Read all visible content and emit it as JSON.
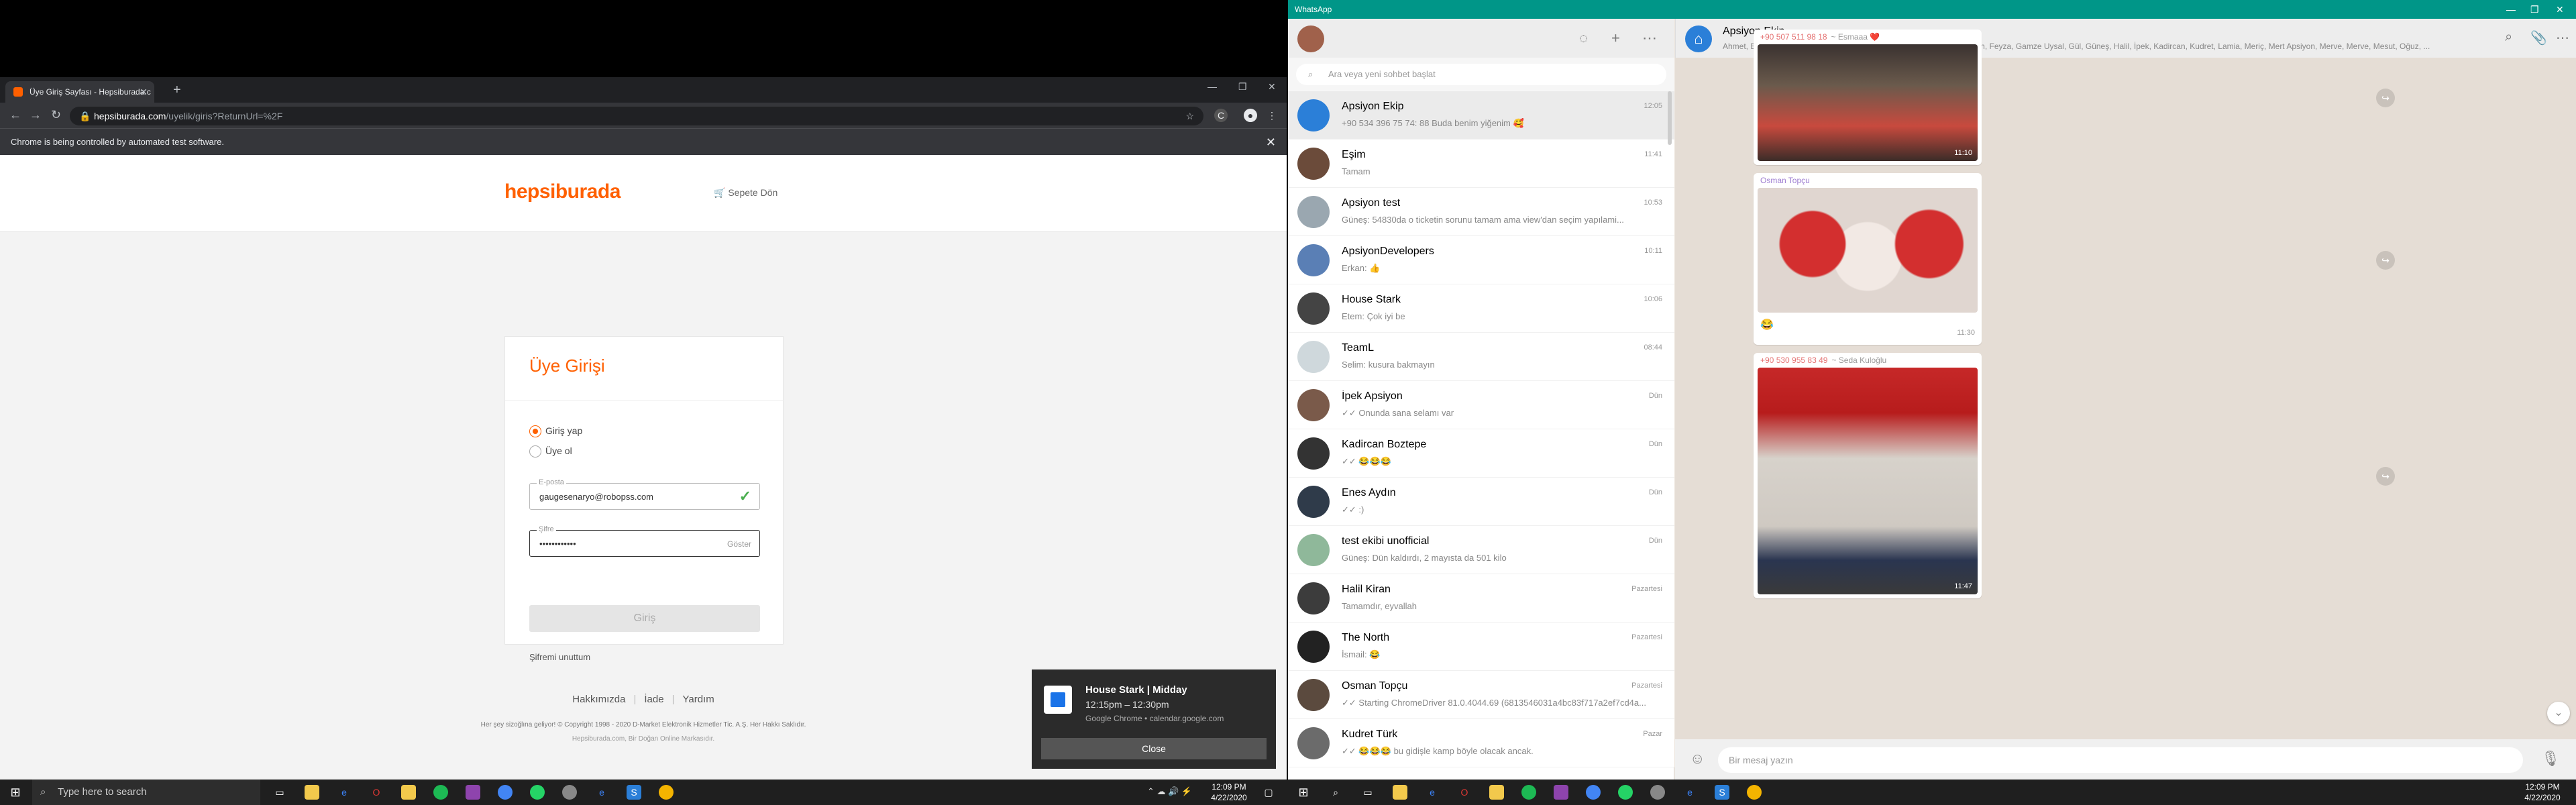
{
  "chrome": {
    "tab_title": "Üye Giriş Sayfası - Hepsiburada.c",
    "url_host": "hepsiburada.com",
    "url_path": "/uyelik/giris?ReturnUrl=%2F",
    "infobar": "Chrome is being controlled by automated test software."
  },
  "hepsiburada": {
    "logo": "hepsiburada",
    "cart_link": "Sepete Dön",
    "login_title": "Üye Girişi",
    "radio_login": "Giriş yap",
    "radio_register": "Üye ol",
    "email_label": "E-posta",
    "email_value": "gaugesenaryo@robopss.com",
    "password_label": "Şifre",
    "password_value": "••••••••••••",
    "show_label": "Göster",
    "login_button": "Giriş",
    "forgot_link": "Şifremi unuttum",
    "footer_links": [
      "Hakkımızda",
      "İade",
      "Yardım"
    ],
    "copyright": "Her şey sizoğlına geliyor! © Copyright 1998 - 2020 D-Market Elektronik Hizmetler Tic. A.Ş. Her Hakkı Saklıdır.",
    "sub_copyright": "Hepsiburada.com, Bir Doğan Online Markasıdır."
  },
  "toast": {
    "title": "House Stark | Midday",
    "time": "12:15pm – 12:30pm",
    "source": "Google Chrome • calendar.google.com",
    "close": "Close"
  },
  "taskbar_left": {
    "search_placeholder": "Type here to search",
    "time": "12:09 PM",
    "date": "4/22/2020"
  },
  "taskbar_right": {
    "time": "12:09 PM",
    "date": "4/22/2020"
  },
  "whatsapp": {
    "app_title": "WhatsApp",
    "search_placeholder": "Ara veya yeni sohbet başlat",
    "chats": [
      {
        "name": "Apsiyon Ekip",
        "time": "12:05",
        "preview": "+90 534 396 75 74: 88 Buda benim yiğenim 🥰",
        "color": "#2b7fd8"
      },
      {
        "name": "Eşim",
        "time": "11:41",
        "preview": "Tamam",
        "color": "#6b4b3a"
      },
      {
        "name": "Apsiyon test",
        "time": "10:53",
        "preview": "Güneş: 54830da o ticketin sorunu tamam ama view'dan seçim yapılami...",
        "color": "#9aa7b0"
      },
      {
        "name": "ApsiyonDevelopers",
        "time": "10:11",
        "preview": "Erkan: 👍",
        "color": "#5a7fb5"
      },
      {
        "name": "House Stark",
        "time": "10:06",
        "preview": "Etem: Çok iyi be",
        "color": "#444444"
      },
      {
        "name": "TeamL",
        "time": "08:44",
        "preview": "Selim: kusura bakmayın",
        "color": "#cfd8dc"
      },
      {
        "name": "İpek Apsiyon",
        "time": "Dün",
        "preview": "✓✓ Onunda sana selamı var",
        "color": "#7a5a4a"
      },
      {
        "name": "Kadircan Boztepe",
        "time": "Dün",
        "preview": "✓✓ 😂😂😂",
        "color": "#333333"
      },
      {
        "name": "Enes Aydın",
        "time": "Dün",
        "preview": "✓✓ :)",
        "color": "#2f3b4a"
      },
      {
        "name": "test ekibi unofficial",
        "time": "Dün",
        "preview": "Güneş: Dün kaldırdı, 2 mayısta da 501 kilo",
        "color": "#8fb89a"
      },
      {
        "name": "Halil Kiran",
        "time": "Pazartesi",
        "preview": "Tamamdır, eyvallah",
        "color": "#3c3c3c"
      },
      {
        "name": "The North",
        "time": "Pazartesi",
        "preview": "İsmail: 😂",
        "color": "#222222"
      },
      {
        "name": "Osman Topçu",
        "time": "Pazartesi",
        "preview": "✓✓ Starting ChromeDriver 81.0.4044.69 (6813546031a4bc83f717a2ef7cd4a...",
        "color": "#5b4a3e"
      },
      {
        "name": "Kudret Türk",
        "time": "Pazar",
        "preview": "✓✓ 😂😂😂 bu gidişle kamp böyle olacak ancak.",
        "color": "#6b6b6b"
      }
    ],
    "conversation": {
      "name": "Apsiyon Ekip",
      "members": "Ahmet, Bahar, Büşra, Can, Cem, Deniz, Dilan, Erkan, Erman, Etem, Fatih, Feyza, Gamze Uysal, Gül, Güneş, Halil, İpek, Kadircan, Kudret, Lamia, Meriç, Mert Apsiyon, Merve, Merve, Mesut, Oğuz, ...",
      "messages": [
        {
          "sender": "+90 507 511 98 18",
          "nick": "~ Esmaaa ❤️",
          "time": "11:10",
          "sender_color": "#e57373"
        },
        {
          "sender": "Osman Topçu",
          "nick": "",
          "caption": "😂",
          "time": "11:30",
          "sender_color": "#9c7bd0"
        },
        {
          "sender": "+90 530 955 83 49",
          "nick": "~ Seda Kuloğlu",
          "time": "11:47",
          "sender_color": "#e57373"
        }
      ],
      "compose_placeholder": "Bir mesaj yazın"
    }
  }
}
